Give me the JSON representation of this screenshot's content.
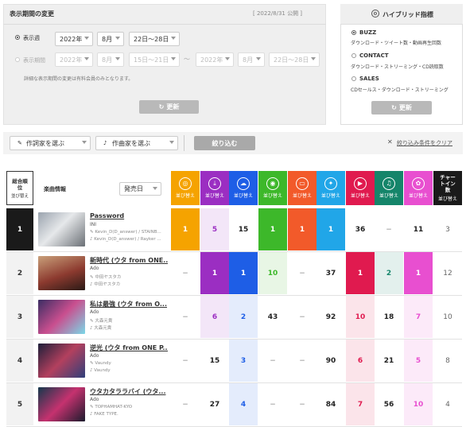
{
  "period": {
    "title": "表示期間の変更",
    "published": "[ 2022/8/31 公開 ]",
    "radio_week": "表示週",
    "year": "2022年",
    "month": "8月",
    "week": "22日〜28日",
    "radio_range": "表示期間",
    "range_start_year": "2022年",
    "range_start_month": "8月",
    "range_start_week": "15日〜21日",
    "tilde": "〜",
    "range_end_year": "2022年",
    "range_end_month": "8月",
    "range_end_week": "22日〜28日",
    "note": "詳細な表示期間の変更は有料会員のみとなります。",
    "update": "更新"
  },
  "hybrid": {
    "title": "ハイブリッド指標",
    "options": [
      {
        "label": "BUZZ",
        "desc": "ダウンロード・ツイート数・動画再生回数"
      },
      {
        "label": "CONTACT",
        "desc": "ダウンロード・ストリーミング・CD読取数"
      },
      {
        "label": "SALES",
        "desc": "CDセールス・ダウンロード・ストリーミング"
      }
    ],
    "update": "更新"
  },
  "filters": {
    "composer": "作詞家を選ぶ",
    "lyricist": "作曲家を選ぶ",
    "narrow": "絞り込む",
    "clear": "絞り込み条件をクリア"
  },
  "table": {
    "rank_header": "総合順位",
    "sort": "並び替え",
    "music_header": "楽曲情報",
    "date_select": "発売日",
    "chart_in": "チャートイン数",
    "columns": [
      {
        "icon": "cd-icon",
        "color": "#f5a300"
      },
      {
        "icon": "download-icon",
        "color": "#9b2ec2"
      },
      {
        "icon": "cloud-download-icon",
        "color": "#1e5ee6"
      },
      {
        "icon": "streaming-icon",
        "color": "#3db82a"
      },
      {
        "icon": "pc-icon",
        "color": "#f25a2a"
      },
      {
        "icon": "twitter-icon",
        "color": "#21a6e8"
      },
      {
        "icon": "youtube-icon",
        "color": "#e01a4f"
      },
      {
        "icon": "karaoke-icon",
        "color": "#15856a"
      },
      {
        "icon": "gyao-icon",
        "color": "#e84fd0"
      },
      {
        "icon": "",
        "color": "#1a1a1a"
      }
    ],
    "rows": [
      {
        "rank": "1",
        "title": "Password",
        "artist": "INI",
        "credit1": "Kevin_D(D_answer) / STAINB...",
        "credit2": "Kevin_D(D_answer) / Rayker ...",
        "values": [
          "1",
          "5",
          "15",
          "1",
          "1",
          "1",
          "36",
          "−",
          "11",
          "3"
        ]
      },
      {
        "rank": "2",
        "title": "新時代 (ウタ from ONE...",
        "artist": "Ado",
        "credit1": "中田ヤスタカ",
        "credit2": "中田ヤスタカ",
        "values": [
          "−",
          "1",
          "1",
          "10",
          "−",
          "37",
          "1",
          "2",
          "1",
          "12"
        ]
      },
      {
        "rank": "3",
        "title": "私は最強 (ウタ from O...",
        "artist": "Ado",
        "credit1": "大森元貴",
        "credit2": "大森元貴",
        "values": [
          "−",
          "6",
          "2",
          "43",
          "−",
          "92",
          "10",
          "18",
          "7",
          "10"
        ]
      },
      {
        "rank": "4",
        "title": "逆光 (ウタ from ONE P...",
        "artist": "Ado",
        "credit1": "Vaundy",
        "credit2": "Vaundy",
        "values": [
          "−",
          "15",
          "3",
          "−",
          "−",
          "90",
          "6",
          "21",
          "5",
          "8"
        ]
      },
      {
        "rank": "5",
        "title": "ウタカタララバイ (ウタ...",
        "artist": "Ado",
        "credit1": "TOPHAMHAT-KYO",
        "credit2": "FAKE TYPE.",
        "values": [
          "−",
          "27",
          "4",
          "−",
          "−",
          "84",
          "7",
          "56",
          "10",
          "4"
        ]
      }
    ]
  }
}
